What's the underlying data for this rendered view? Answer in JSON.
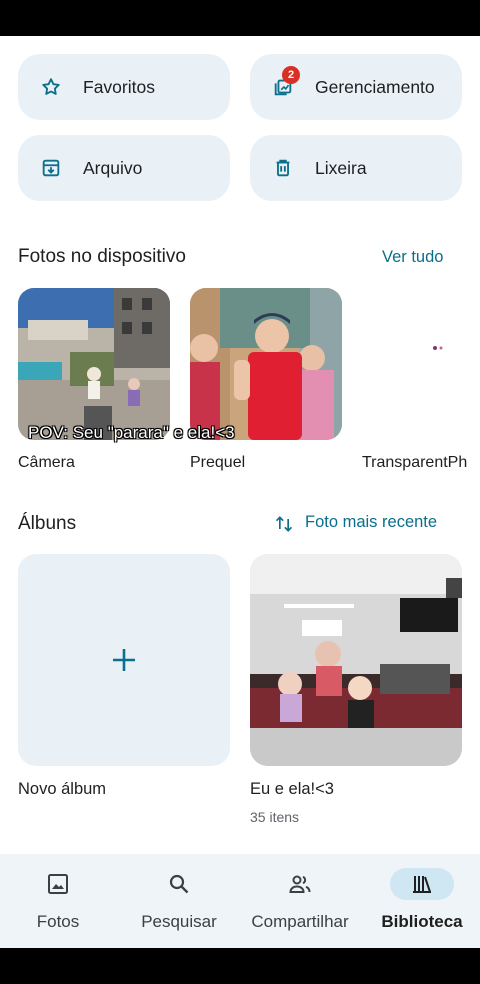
{
  "tiles": {
    "favorites": {
      "label": "Favoritos",
      "icon": "star-icon"
    },
    "management": {
      "label": "Gerenciamento",
      "icon": "management-icon",
      "badge": "2"
    },
    "archive": {
      "label": "Arquivo",
      "icon": "archive-icon"
    },
    "trash": {
      "label": "Lixeira",
      "icon": "trash-icon"
    }
  },
  "device_photos": {
    "title": "Fotos no dispositivo",
    "see_all": "Ver tudo",
    "folders": [
      {
        "label": "Câmera"
      },
      {
        "label": "Prequel"
      },
      {
        "label": "TransparentPh"
      }
    ]
  },
  "albums": {
    "title": "Álbuns",
    "sort_label": "Foto mais recente",
    "new_album": {
      "label": "Novo álbum",
      "icon": "plus-icon"
    },
    "items": [
      {
        "name": "Eu e ela!<3",
        "count": "35 itens"
      }
    ]
  },
  "overlay_caption": "POV: Seu \"parara\" e ela!<3",
  "nav": {
    "items": [
      {
        "label": "Fotos",
        "icon": "photo-icon"
      },
      {
        "label": "Pesquisar",
        "icon": "search-icon"
      },
      {
        "label": "Compartilhar",
        "icon": "people-icon"
      },
      {
        "label": "Biblioteca",
        "icon": "library-icon",
        "active": true
      }
    ]
  },
  "colors": {
    "accent": "#0b6e8a",
    "tile_bg": "#e9f1f6",
    "badge": "#d93025",
    "nav_bg": "#eef4f8"
  }
}
